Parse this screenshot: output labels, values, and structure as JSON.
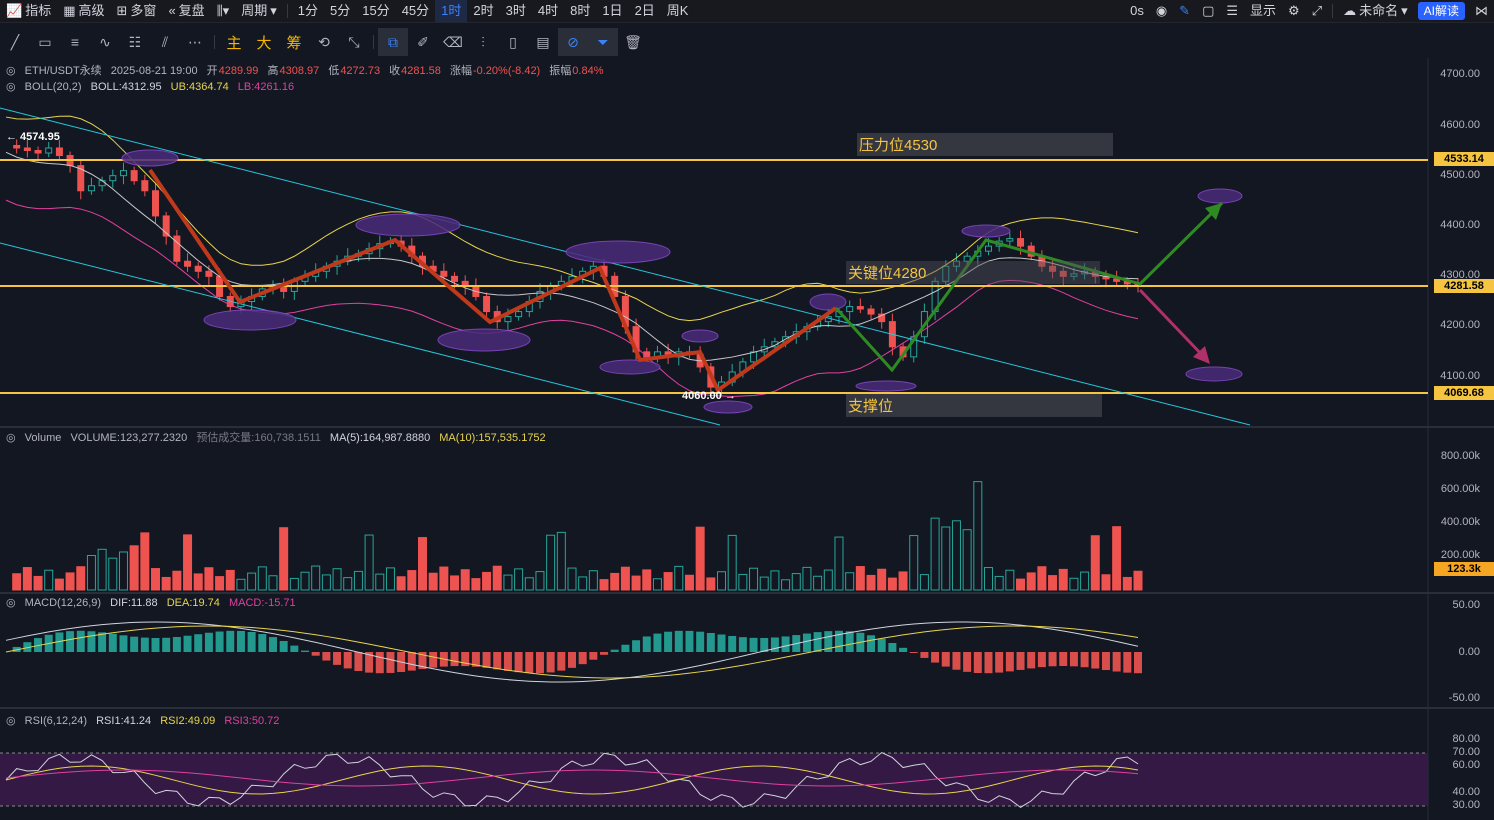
{
  "topbar": {
    "items": [
      {
        "label": "指标",
        "icon": "indicator-icon"
      },
      {
        "label": "高级",
        "icon": "advanced-icon"
      },
      {
        "label": "多窗",
        "icon": "multi-window-icon"
      },
      {
        "label": "复盘",
        "icon": "replay-icon"
      },
      {
        "label": "",
        "icon": "chart-type-icon"
      },
      {
        "label": "周期",
        "icon": ""
      }
    ],
    "intervals": [
      "1分",
      "5分",
      "15分",
      "45分",
      "1时",
      "2时",
      "3时",
      "4时",
      "8时",
      "1日",
      "2日",
      "周K"
    ],
    "active_interval": "1时",
    "right": {
      "countdown": "0s",
      "display_label": "显示",
      "user_label": "未命名",
      "ai_label": "AI解读"
    }
  },
  "toolbar": {
    "gold_labels": [
      "主",
      "大",
      "筹"
    ]
  },
  "main_legend": {
    "symbol": "ETH/USDT永续",
    "datetime": "2025-08-21 19:00",
    "open_label": "开",
    "open": "4289.99",
    "high_label": "高",
    "high": "4308.97",
    "low_label": "低",
    "low": "4272.73",
    "close_label": "收",
    "close": "4281.58",
    "change_label": "涨幅",
    "change": "-0.20%(-8.42)",
    "amp_label": "振幅",
    "amp": "0.84%",
    "boll_name": "BOLL(20,2)",
    "boll": "BOLL:4312.95",
    "ub": "UB:4364.74",
    "lb": "LB:4261.16"
  },
  "price_axis": [
    "4700.00",
    "4600.00",
    "4500.00",
    "4400.00",
    "4300.00",
    "4200.00",
    "4100.00"
  ],
  "price_tags": {
    "resistance": "4533.14",
    "current": "4281.58",
    "support": "4069.68"
  },
  "annotations": {
    "resistance": "压力位4530",
    "key": "关键位4280",
    "support": "支撑位",
    "high_point": "← 4574.95",
    "low_point": "4060.00 →"
  },
  "volume_legend": {
    "name": "Volume",
    "volume": "VOLUME:123,277.2320",
    "est": "预估成交量:160,738.1511",
    "ma5": "MA(5):164,987.8880",
    "ma10": "MA(10):157,535.1752"
  },
  "volume_axis": [
    "800.00k",
    "600.00k",
    "400.00k",
    "200.00k"
  ],
  "volume_tag": "123.3k",
  "macd_legend": {
    "name": "MACD(12,26,9)",
    "dif": "DIF:11.88",
    "dea": "DEA:19.74",
    "macd": "MACD:-15.71"
  },
  "macd_axis": [
    "50.00",
    "0.00",
    "-50.00"
  ],
  "rsi_legend": {
    "name": "RSI(6,12,24)",
    "rsi1": "RSI1:41.24",
    "rsi2": "RSI2:49.09",
    "rsi3": "RSI3:50.72"
  },
  "rsi_axis": [
    "80.00",
    "70.00",
    "60.00",
    "40.00",
    "30.00"
  ],
  "colors": {
    "up": "#26a69a",
    "down": "#ef5350",
    "gold": "#f5c542",
    "boll_ub": "#e8d44d",
    "boll_mid": "#c8c8c8",
    "boll_lb": "#e040a0",
    "channel": "#26c6da",
    "brown_zigzag": "#c0391b",
    "green_path": "#2e8b22",
    "purple_arrow": "#b0306a"
  }
}
